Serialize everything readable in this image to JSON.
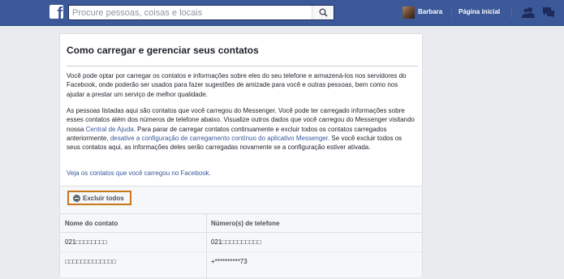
{
  "topbar": {
    "logo_letter": "f",
    "search_placeholder": "Procure pessoas, coisas e locais",
    "user_name": "Barbara",
    "home_label": "Página inicial",
    "icons": [
      "facebook-logo",
      "search-icon",
      "friends-icon",
      "messages-icon"
    ],
    "bar_color": "#3b5998"
  },
  "card": {
    "title": "Como carregar e gerenciar seus contatos",
    "p1": "Você pode optar por carregar os contatos e informações sobre eles do seu telefone e armazená-los nos servidores do Facebook, onde poderão ser usados para fazer sugestões de amizade para você e outras pessoas, bem como nos ajudar a prestar um serviço de melhor qualidade.",
    "p2_a": "As pessoas listadas aqui são contatos que você carregou do Messenger. Você pode ter carregado informações sobre esses contatos além dos números de telefone abaixo. Visualize outros dados que você carregou do Messenger visitando nossa ",
    "p2_link1": "Central de Ajuda",
    "p2_b": ". Para parar de carregar contatos continuamente e excluir todos os contatos carregados anteriormente, ",
    "p2_link2": "desative a configuração de carregamento contínuo do aplicativo Messenger",
    "p2_c": ". Se você excluir todos os seus contatos aqui, as informações deles serão carregadas novamente se a configuração estiver ativada.",
    "p3_link": "Veja os contatos que você carregou no Facebook.",
    "delete_all_label": "Excluir todos",
    "accent_color": "#c8761c",
    "link_color": "#365899"
  },
  "table": {
    "headers": [
      "Nome do contato",
      "Número(s) de telefone"
    ],
    "rows": [
      [
        "021□□□□□□□□",
        "021□□□□□□□□□□"
      ],
      [
        "□□□□□□□□□□□□□",
        "+**********73"
      ]
    ]
  }
}
